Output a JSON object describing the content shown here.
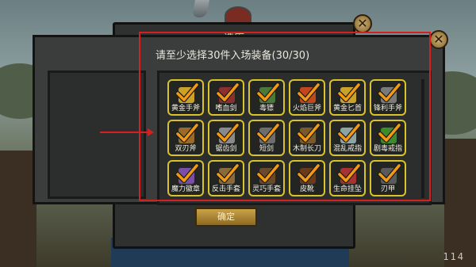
{
  "dialog": {
    "title": "请至少选择30件入场装备(30/30)",
    "confirm_label": "确定"
  },
  "behind": {
    "title": "选库"
  },
  "close_symbol": "✕",
  "counter": "114",
  "items": [
    {
      "label": "黄金手斧",
      "icon": "axe-icon",
      "color": "#c9a227"
    },
    {
      "label": "嗜血剑",
      "icon": "sword-icon",
      "color": "#8b2f2f"
    },
    {
      "label": "毒镖",
      "icon": "dart-icon",
      "color": "#4a7a3a"
    },
    {
      "label": "火焰巨斧",
      "icon": "fire-axe-icon",
      "color": "#c2471d"
    },
    {
      "label": "黄金匕首",
      "icon": "dagger-icon",
      "color": "#c9a227"
    },
    {
      "label": "锋利手斧",
      "icon": "axe-icon",
      "color": "#7a7a7a"
    },
    {
      "label": "双刃斧",
      "icon": "double-axe-icon",
      "color": "#9a6a2a"
    },
    {
      "label": "锯齿剑",
      "icon": "saw-sword-icon",
      "color": "#8a8a8a"
    },
    {
      "label": "短剑",
      "icon": "short-sword-icon",
      "color": "#6d6d6d"
    },
    {
      "label": "木制长刀",
      "icon": "wooden-blade-icon",
      "color": "#7a5a2a"
    },
    {
      "label": "混乱戒指",
      "icon": "ring-icon",
      "color": "#8fa3a3"
    },
    {
      "label": "剧毒戒指",
      "icon": "poison-ring-icon",
      "color": "#3c8c2c"
    },
    {
      "label": "魔力徽章",
      "icon": "badge-icon",
      "color": "#7b4fa8"
    },
    {
      "label": "反击手套",
      "icon": "glove-icon",
      "color": "#8a6a3a"
    },
    {
      "label": "灵巧手套",
      "icon": "glove-icon",
      "color": "#6a4a2a"
    },
    {
      "label": "皮靴",
      "icon": "boots-icon",
      "color": "#6a3a1a"
    },
    {
      "label": "生命挂坠",
      "icon": "pendant-icon",
      "color": "#a83232"
    },
    {
      "label": "刃甲",
      "icon": "armor-icon",
      "color": "#5a5a5a"
    }
  ]
}
